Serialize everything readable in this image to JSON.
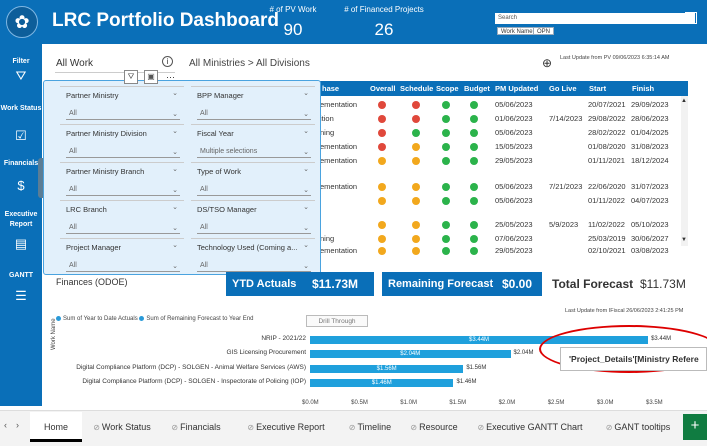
{
  "header": {
    "title": "LRC Portfolio Dashboard",
    "kpi1_label": "# of PV Work",
    "kpi1_value": "90",
    "kpi2_label": "# of Financed Projects",
    "kpi2_value": "26",
    "search_placeholder": "Search",
    "btn_work_name": "Work Name",
    "btn_opn": "OPN"
  },
  "sidebar": {
    "items": [
      {
        "label": "Filter",
        "icon": "filter-icon"
      },
      {
        "label": "Work Status",
        "icon": "status-icon"
      },
      {
        "label": "Financials",
        "icon": "dollar-icon"
      },
      {
        "label": "Executive Report",
        "icon": "report-icon"
      },
      {
        "label": "GANTT",
        "icon": "gantt-icon"
      }
    ]
  },
  "main": {
    "all_work": "All Work",
    "breadcrumb": "All Ministries > All Divisions",
    "last_update_top": "Last Update from PV 09/06/2023 6:35:14 AM",
    "last_update_fin": "Last Update from IFiscal 26/06/2023 2:41:25 PM"
  },
  "table": {
    "headers": [
      "hase",
      "Overall",
      "Schedule",
      "Scope",
      "Budget",
      "PM Updated",
      "Go Live",
      "Start",
      "Finish"
    ],
    "rows": [
      {
        "phase": "ementation",
        "o": "red",
        "s": "red",
        "sc": "green",
        "b": "green",
        "pm": "05/06/2023",
        "go": "",
        "start": "20/07/2021",
        "finish": "29/09/2023"
      },
      {
        "phase": "ition",
        "o": "red",
        "s": "red",
        "sc": "green",
        "b": "green",
        "pm": "01/06/2023",
        "go": "7/14/2023",
        "start": "29/08/2022",
        "finish": "28/06/2023"
      },
      {
        "phase": "ning",
        "o": "red",
        "s": "green",
        "sc": "green",
        "b": "green",
        "pm": "05/06/2023",
        "go": "",
        "start": "28/02/2022",
        "finish": "01/04/2025"
      },
      {
        "phase": "ementation",
        "o": "red",
        "s": "yellow",
        "sc": "green",
        "b": "green",
        "pm": "15/05/2023",
        "go": "",
        "start": "01/08/2020",
        "finish": "31/08/2023"
      },
      {
        "phase": "ementation",
        "o": "yellow",
        "s": "yellow",
        "sc": "green",
        "b": "green",
        "pm": "29/05/2023",
        "go": "",
        "start": "01/11/2021",
        "finish": "18/12/2024"
      },
      {
        "phase": "",
        "o": "",
        "s": "",
        "sc": "",
        "b": "",
        "pm": "",
        "go": "",
        "start": "",
        "finish": ""
      },
      {
        "phase": "ementation",
        "o": "yellow",
        "s": "yellow",
        "sc": "green",
        "b": "green",
        "pm": "05/06/2023",
        "go": "7/21/2023",
        "start": "22/06/2020",
        "finish": "31/07/2023"
      },
      {
        "phase": "",
        "o": "yellow",
        "s": "yellow",
        "sc": "green",
        "b": "green",
        "pm": "05/06/2023",
        "go": "",
        "start": "01/11/2022",
        "finish": "04/07/2023"
      },
      {
        "phase": "",
        "o": "",
        "s": "",
        "sc": "",
        "b": "",
        "pm": "",
        "go": "",
        "start": "",
        "finish": ""
      },
      {
        "phase": "",
        "o": "yellow",
        "s": "yellow",
        "sc": "green",
        "b": "green",
        "pm": "25/05/2023",
        "go": "5/9/2023",
        "start": "11/02/2022",
        "finish": "05/10/2023"
      },
      {
        "phase": "ning",
        "o": "yellow",
        "s": "yellow",
        "sc": "green",
        "b": "green",
        "pm": "07/06/2023",
        "go": "",
        "start": "25/03/2019",
        "finish": "30/06/2027"
      },
      {
        "phase": "ementation",
        "o": "yellow",
        "s": "yellow",
        "sc": "green",
        "b": "green",
        "pm": "29/05/2023",
        "go": "",
        "start": "02/10/2021",
        "finish": "03/08/2023"
      }
    ]
  },
  "filters": [
    {
      "label": "Partner Ministry",
      "value": "All"
    },
    {
      "label": "BPP Manager",
      "value": "All"
    },
    {
      "label": "Partner Ministry Division",
      "value": "All"
    },
    {
      "label": "Fiscal Year",
      "value": "Multiple selections"
    },
    {
      "label": "Partner Ministry Branch",
      "value": "All"
    },
    {
      "label": "Type of Work",
      "value": "All"
    },
    {
      "label": "LRC Branch",
      "value": "All"
    },
    {
      "label": "DS/TSO Manager",
      "value": "All"
    },
    {
      "label": "Project Manager",
      "value": "All"
    },
    {
      "label": "Technology Used (Coming a...",
      "value": "All"
    }
  ],
  "finance": {
    "section_label": "Finances (ODOE)",
    "ytd_label": "YTD Actuals",
    "ytd_value": "$11.73M",
    "rem_label": "Remaining Forecast",
    "rem_value": "$0.00",
    "total_label": "Total Forecast",
    "total_value": "$11.73M",
    "legend1": "Sum of Year to Date Actuals",
    "legend2": "Sum of Remaining Forecast to Year End",
    "drill": "Drill Through",
    "axis_label": "Work Name",
    "axis_title": "Sum of Year to Date Actuals and Sum of Remaining Forecast to Year End"
  },
  "chart_data": {
    "type": "bar",
    "orientation": "horizontal",
    "categories": [
      "NRIP - 2021/22",
      "GIS Licensing Procurement",
      "Digital Compliance Platform (DCP) - SOLGEN - Animal Welfare Services (AWS)",
      "Digital Compliance Platform (DCP) - SOLGEN - Inspectorate of Policing (IOP)"
    ],
    "series": [
      {
        "name": "Sum of Year to Date Actuals",
        "values": [
          3.44,
          2.04,
          1.56,
          1.46
        ]
      }
    ],
    "labels": [
      "$3.44M",
      "$2.04M",
      "$1.56M",
      "$1.46M"
    ],
    "ticks": [
      "$0.0M",
      "$0.5M",
      "$1.0M",
      "$1.5M",
      "$2.0M",
      "$2.5M",
      "$3.0M",
      "$3.5M"
    ],
    "xlim": [
      0,
      3.5
    ],
    "ylabel": "Work Name"
  },
  "tooltip": {
    "text": "'Project_Details'[Ministry Refere"
  },
  "tabs": [
    {
      "label": "Home",
      "active": true
    },
    {
      "label": "Work Status"
    },
    {
      "label": "Financials"
    },
    {
      "label": "Executive Report"
    },
    {
      "label": "Timeline"
    },
    {
      "label": "Resource"
    },
    {
      "label": "Executive GANTT Chart"
    },
    {
      "label": "GANT tooltips"
    }
  ],
  "colors": {
    "brand": "#0a6fb8",
    "red": "#e0483b",
    "yellow": "#f2a81d",
    "green": "#2bb34b",
    "bar": "#1fa0dc"
  }
}
